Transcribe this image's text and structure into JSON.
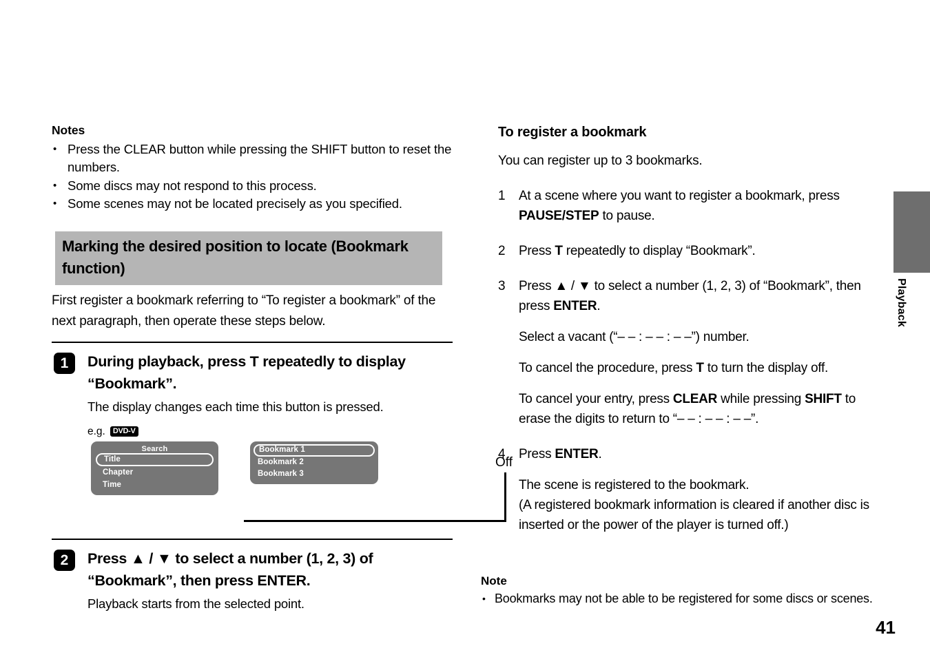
{
  "left_column": {
    "notes": {
      "heading": "Notes",
      "items": [
        "Press the CLEAR button while pressing the SHIFT button to reset the numbers.",
        "Some discs may not respond to this process.",
        "Some scenes may not be located precisely as you specified."
      ],
      "bullet_glyph": "•"
    },
    "section_heading": "Marking the desired position to locate (Bookmark function)",
    "intro_paragraph": "First register a bookmark referring to “To register a bookmark” of the next paragraph, then operate these steps below.",
    "steps": [
      {
        "number": "1",
        "title": "During playback, press T repeatedly to display “Bookmark”.",
        "sub": "The display changes each time this button is pressed."
      },
      {
        "number": "2",
        "title": "Press ▲ / ▼ to select a number (1, 2, 3) of “Bookmark”, then press ENTER.",
        "sub": "Playback starts from the selected point."
      }
    ],
    "diagram": {
      "eg_label": "e.g.",
      "disc_badge": "DVD-V",
      "search_menu": {
        "title": "Search",
        "items": [
          "Title",
          "Chapter",
          "Time"
        ],
        "selected": "Title"
      },
      "bookmark_menu": {
        "items": [
          "Bookmark 1",
          "Bookmark 2",
          "Bookmark 3"
        ],
        "selected": "Bookmark 1"
      },
      "off_label": "Off"
    }
  },
  "right_column": {
    "heading": "To register a bookmark",
    "intro": "You can register up to 3 bookmarks.",
    "steps": [
      {
        "number": "1",
        "lines": [
          "At a scene where you want to register a bookmark, press PAUSE/STEP to pause."
        ]
      },
      {
        "number": "2",
        "lines": [
          "Press T repeatedly to display “Bookmark”."
        ]
      },
      {
        "number": "3",
        "lines": [
          "Press ▲ / ▼ to select a number (1, 2, 3) of “Bookmark”, then press ENTER.",
          "Select a vacant (“– – : – – : – –”) number.",
          "To cancel the procedure, press T to turn the display off.",
          "To cancel your entry, press CLEAR while pressing SHIFT to erase the digits to return to “– – : – – : – –”."
        ]
      },
      {
        "number": "4",
        "lines": [
          "Press ENTER.",
          "The scene is registered to the bookmark.",
          "(A registered bookmark information is cleared if another disc is inserted or the power of the player is turned off.)"
        ]
      }
    ],
    "note": {
      "heading": "Note",
      "items": [
        "Bookmarks may not be able to be registered for some discs or scenes."
      ],
      "bullet_glyph": "•"
    }
  },
  "side_tab": {
    "label": "Playback",
    "color": "#6e6e6e"
  },
  "page_number": "41",
  "colors": {
    "section_heading_bg": "#b5b5b5",
    "osd_bg": "#767676",
    "side_tab": "#6e6e6e"
  }
}
